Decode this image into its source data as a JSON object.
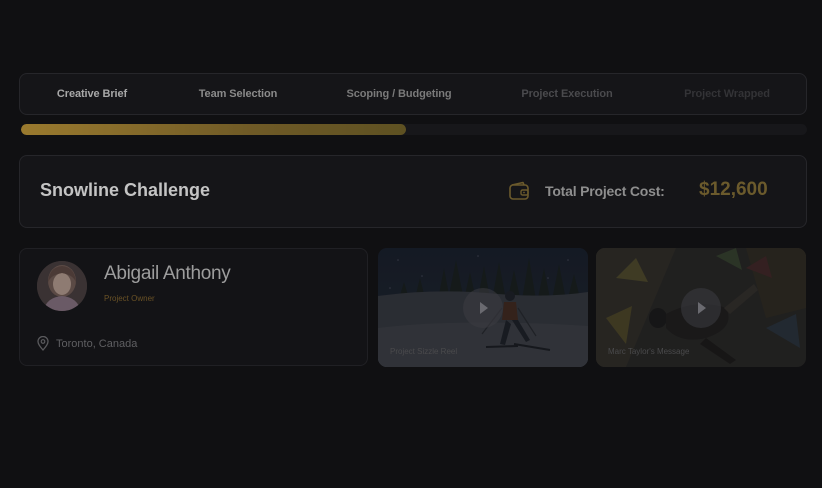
{
  "steps": [
    {
      "label": "Creative Brief"
    },
    {
      "label": "Team Selection"
    },
    {
      "label": "Scoping / Budgeting"
    },
    {
      "label": "Project Execution"
    },
    {
      "label": "Project Wrapped"
    }
  ],
  "progress": {
    "percent": 49
  },
  "project": {
    "title": "Snowline Challenge",
    "cost_label": "Total Project Cost:",
    "cost_value": "$12,600",
    "wallet_icon": "wallet-icon"
  },
  "owner": {
    "name": "Abigail Anthony",
    "role": "Project Owner",
    "location": "Toronto, Canada",
    "location_icon": "map-pin-icon"
  },
  "media": [
    {
      "caption": "Project Sizzle Reel",
      "icon": "play-icon"
    },
    {
      "caption": "Marc Taylor's Message",
      "icon": "play-icon"
    }
  ],
  "colors": {
    "accent": "#9a7a2e",
    "background": "#101012",
    "card": "#151518"
  }
}
